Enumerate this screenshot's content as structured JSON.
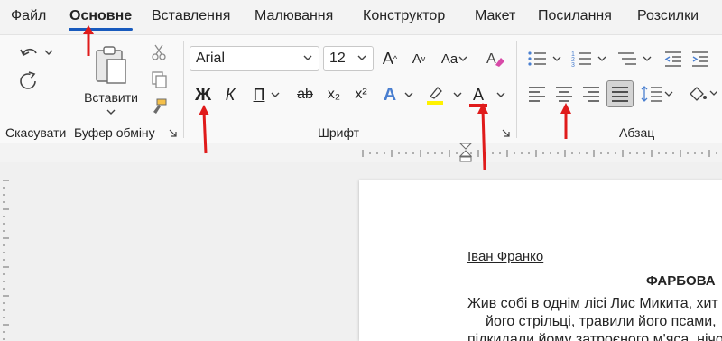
{
  "tabs": [
    "Файл",
    "Основне",
    "Вставлення",
    "Малювання",
    "Конструктор",
    "Макет",
    "Посилання",
    "Розсилки"
  ],
  "ribbon": {
    "undo_group_label": "Скасувати",
    "clipboard": {
      "paste_label": "Вставити",
      "group_label": "Буфер обміну"
    },
    "font": {
      "family": "Arial",
      "size": "12",
      "bold_glyph": "Ж",
      "italic_glyph": "К",
      "underline_glyph": "П",
      "strike_glyph": "ab",
      "sub_glyph": "x₂",
      "super_glyph": "x²",
      "effects_glyph": "A",
      "color_glyph": "A",
      "color_bar": "#e01b1b",
      "highlight_bar": "#fff200",
      "grow_glyph": "A",
      "shrink_glyph": "A",
      "case_glyph": "Aa",
      "group_label": "Шрифт"
    },
    "paragraph": {
      "group_label": "Абзац"
    }
  },
  "document": {
    "author": "Іван Франко",
    "title": "ФАРБОВА",
    "lines": [
      "Жив собі в однім лісі Лис Микита, хит",
      "його стрільці, травили його псами,",
      "підкидали йому затроєного м'яса, нічо"
    ]
  },
  "colors": {
    "accent": "#185abd",
    "arrow": "#e01b1b"
  }
}
